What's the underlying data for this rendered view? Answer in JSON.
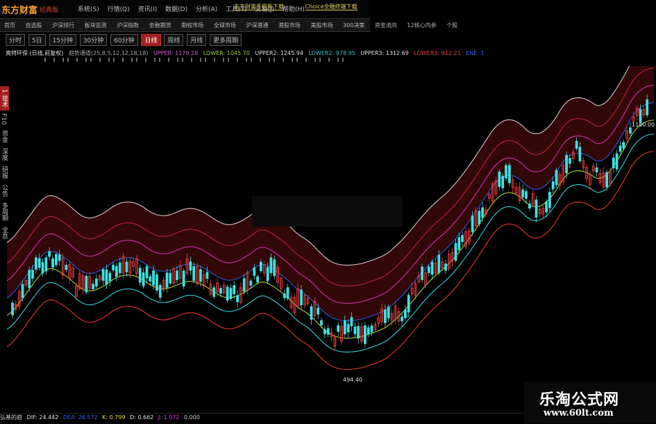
{
  "app": {
    "brand": "东方财富",
    "edition": "经典版"
  },
  "menu": [
    "系统(S)",
    "行情(Q)",
    "资讯(I)",
    "数据(D)",
    "分析(A)",
    "工具(T)",
    "交易(J)",
    "帮助(H)"
  ],
  "ads": [
    "东方财富手机新下载",
    "Choice全融终端下载"
  ],
  "nav": [
    "首页",
    "自选股",
    "沪深排行",
    "板块监测",
    "沪深指数",
    "金融期货",
    "期权市场",
    "全球市场",
    "沪深港通",
    "港股市场",
    "美股市场",
    "300决策",
    "资金流向",
    "12核心内参",
    "个股"
  ],
  "periods": {
    "items": [
      "分时",
      "5日",
      "15分钟",
      "30分钟",
      "60分钟",
      "日线",
      "周线",
      "月线",
      "更多周期"
    ],
    "active": "日线"
  },
  "indicator": {
    "name": "奥特环保 (日线,前复权)",
    "params": "趋势通道(25,8,5,12,12,18,18)",
    "upper": "UPPER: 1179.28",
    "lower": "LOWER: 1045.70",
    "upper2": "UPPER2: 1245.94",
    "lower2": "LOWER2: 978.95",
    "upper3": "UPPER3: 1312.69",
    "lower3": "LOWER3: 912.21",
    "ene": "ENE: 1"
  },
  "left_tabs": [
    "1 技术",
    "F10",
    "资金",
    "深度",
    "研报",
    "公告",
    "多周期",
    "全息",
    "停牌"
  ],
  "left_active": "1 技术",
  "price_labels": {
    "high": "1100.00",
    "low": "494.40"
  },
  "macd": {
    "name": "弘基的趋",
    "dif": "DIF: 24.442",
    "dea": "DEA: 26.572",
    "k": "K: 0.799",
    "d": "D: 0.662",
    "j": "J: 1.072",
    "val": "0.000"
  },
  "watermark": {
    "line1": "乐淘公式网",
    "line2": "www.60lt.com"
  },
  "colors": {
    "band_fill": "#3a0808",
    "band_dots": "#7a1c1c",
    "upper3": "#c8b8b8",
    "upper2": "#b02040",
    "upper": "#c030a0",
    "mid": "#3050d0",
    "lower": "#a0c030",
    "lower2": "#30c0c0",
    "lower3": "#d03030",
    "candle_up": "#ff4040",
    "candle_down": "#40e0e0"
  }
}
